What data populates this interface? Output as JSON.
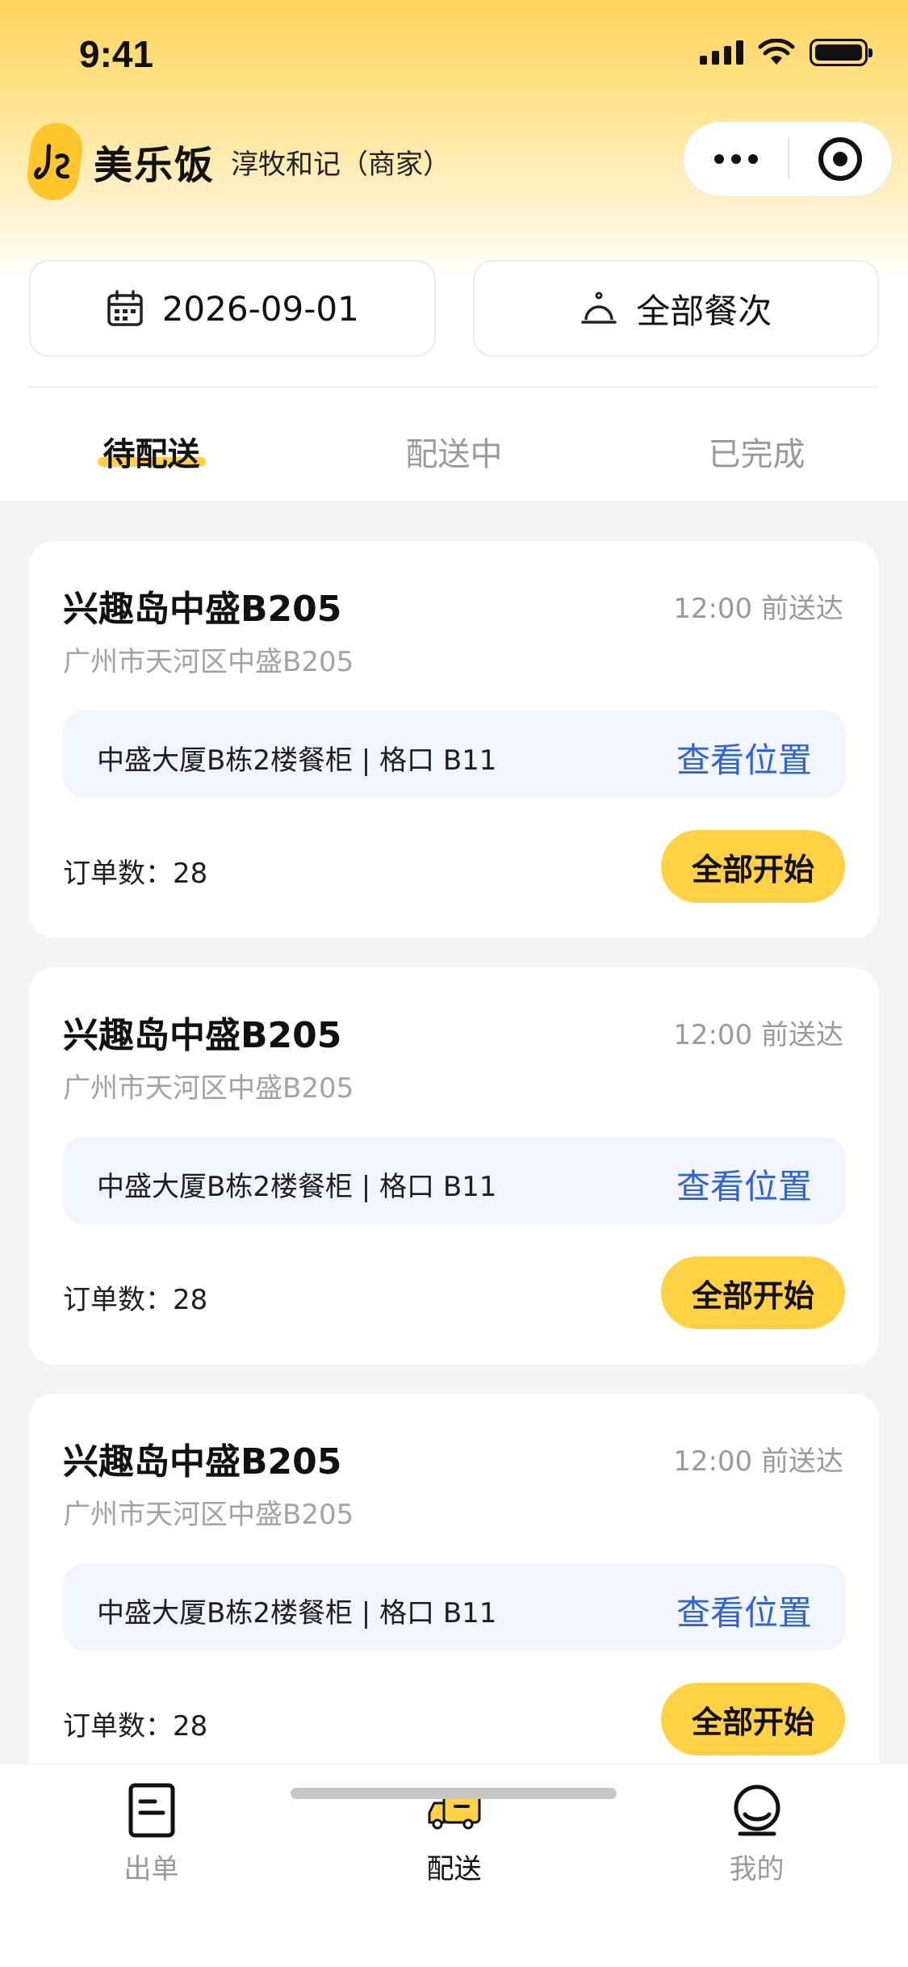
{
  "status_bar": {
    "time": "9:41"
  },
  "header": {
    "brand_name": "美乐饭",
    "merchant": "淳牧和记（商家）"
  },
  "filters": {
    "date": "2026-09-01",
    "meal": "全部餐次"
  },
  "tabs": [
    {
      "label": "待配送",
      "active": true
    },
    {
      "label": "配送中",
      "active": false
    },
    {
      "label": "已完成",
      "active": false
    }
  ],
  "cards": [
    {
      "title": "兴趣岛中盛B205",
      "eta": "12:00 前送达",
      "address": "广州市天河区中盛B205",
      "location": "中盛大厦B栋2楼餐柜 | 格口 B11",
      "location_link": "查看位置",
      "orders": "订单数：28",
      "button": "全部开始"
    },
    {
      "title": "兴趣岛中盛B205",
      "eta": "12:00 前送达",
      "address": "广州市天河区中盛B205",
      "location": "中盛大厦B栋2楼餐柜 | 格口 B11",
      "location_link": "查看位置",
      "orders": "订单数：28",
      "button": "全部开始"
    },
    {
      "title": "兴趣岛中盛B205",
      "eta": "12:00 前送达",
      "address": "广州市天河区中盛B205",
      "location": "中盛大厦B栋2楼餐柜 | 格口 B11",
      "location_link": "查看位置",
      "orders": "订单数：28",
      "button": "全部开始"
    }
  ],
  "tabbar": [
    {
      "label": "出单",
      "icon": "receipt-icon",
      "active": false
    },
    {
      "label": "配送",
      "icon": "delivery-truck-icon",
      "active": true
    },
    {
      "label": "我的",
      "icon": "profile-icon",
      "active": false
    }
  ],
  "colors": {
    "accent": "#ffd145",
    "link": "#2f63d8",
    "location_bg": "#f2f5fd",
    "page_bg": "#f4f4f4"
  }
}
